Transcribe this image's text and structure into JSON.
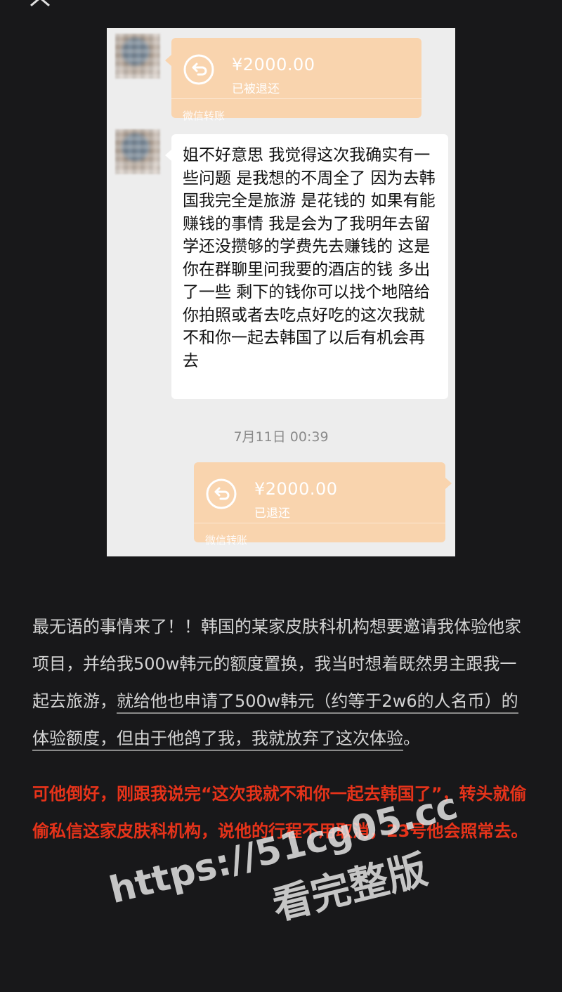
{
  "toolbar": {
    "close_icon": "close-icon"
  },
  "chat": {
    "transfer_top": {
      "amount": "¥2000.00",
      "status": "已被退还",
      "source": "微信转账",
      "icon": "return-arrow-icon"
    },
    "message": "姐不好意思 我觉得这次我确实有一些问题  是我想的不周全了 因为去韩国我完全是旅游 是花钱的 如果有能赚钱的事情 我是会为了我明年去留学还没攒够的学费先去赚钱的 这是你在群聊里问我要的酒店的钱 多出了一些 剩下的钱你可以找个地陪给你拍照或者去吃点好吃的这次我就不和你一起去韩国了以后有机会再去",
    "timestamp": "7月11日 00:39",
    "transfer_bottom": {
      "amount": "¥2000.00",
      "status": "已退还",
      "source": "微信转账",
      "icon": "return-arrow-icon"
    }
  },
  "article": {
    "para1_a": "最无语的事情来了！！韩国的某家皮肤科机构想要邀请我体验他家项目，并给我500w韩元的额度置换，我当时想着既然男主跟我一起去旅游，",
    "para1_b": "就给他也申请了500w韩元（约等于2w6的人名币）的体验额度，但由于他鸽了我，我就放弃了这次体验",
    "para1_c": "。",
    "para2": "可他倒好，刚跟我说完“这次我就不和你一起去韩国了”，转头就偷偷私信这家皮肤科机构，说他的行程不用取消，23号他会照常去。"
  },
  "watermark": {
    "url": "https://51cg05.cc",
    "sub": "看完整版"
  },
  "colors": {
    "background": "#18181a",
    "transfer_bubble": "#f9d4ae",
    "highlight_text": "#e6331a",
    "body_text": "#d4d4d4"
  }
}
